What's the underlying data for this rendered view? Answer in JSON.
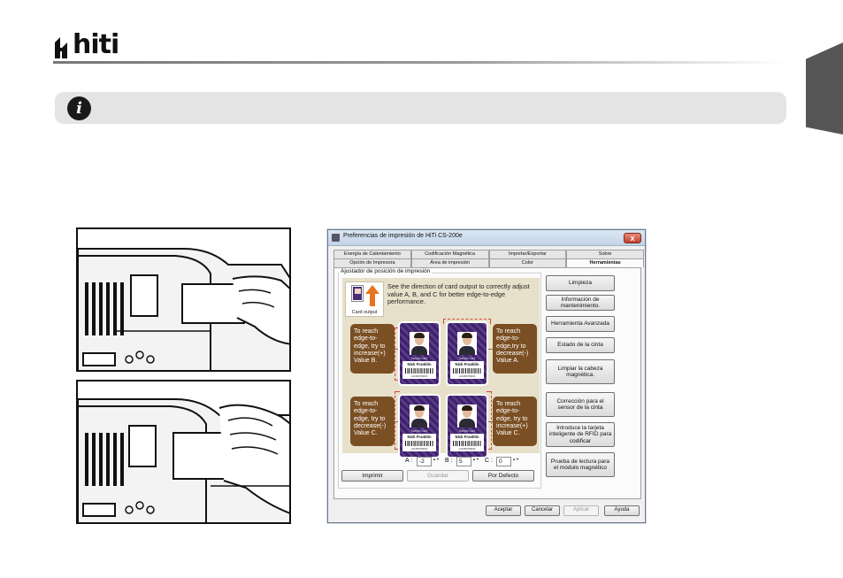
{
  "brand": {
    "logo_text": "hiti"
  },
  "dialog": {
    "title": "Preferencias de impresión de HiTi CS-200e",
    "close_label": "x",
    "tabs_row1": [
      "Energía de Calentamiento",
      "Codificación Magnética",
      "Importar/Exportar",
      "Sobre"
    ],
    "tabs_row2": [
      "Opción de Impresora",
      "Área de impresión",
      "Color",
      "Herramientas"
    ],
    "active_tab": "Herramientas",
    "group_title": "Ajustador de posición de impresión",
    "guide": {
      "card_output_label": "Card output",
      "description": "See the direction of card output to correctly adjust value A, B, and C for better edge-to-edge performance.",
      "note_b": "To reach edge-to-edge, try to increase(+) Value B.",
      "note_a": "To reach edge-to-edge,try to decrease(-) Value A.",
      "note_c_left": "To reach edge-to-edge, try to decrease(-) Value C.",
      "note_c_right": "To reach edge-to-edge, try to increase(+) Value C.",
      "card_header": "Sample Card",
      "card_name": "Nick Franklin",
      "card_code": "123456789000"
    },
    "spin": {
      "a_label": "A :",
      "a_value": "-2",
      "b_label": "B :",
      "b_value": "5",
      "c_label": "C :",
      "c_value": "0",
      "arrows": "▲▼"
    },
    "buttons": {
      "print": "Imprimir",
      "save": "Guardar",
      "default": "Por Defecto"
    },
    "tools": [
      "Limpieza",
      "Información de mantenimiento.",
      "Herramienta Avanzada",
      "Estado de la cinta",
      "Limpiar la cabeza magnética.",
      "Corrección para el sensor de la cinta",
      "Introduce la tarjeta inteligente de RFID para codificar",
      "Prueba de lectura para el módulo magnético"
    ],
    "footer": {
      "ok": "Aceptar",
      "cancel": "Cancelar",
      "apply": "Aplicar",
      "help": "Ayuda"
    }
  }
}
